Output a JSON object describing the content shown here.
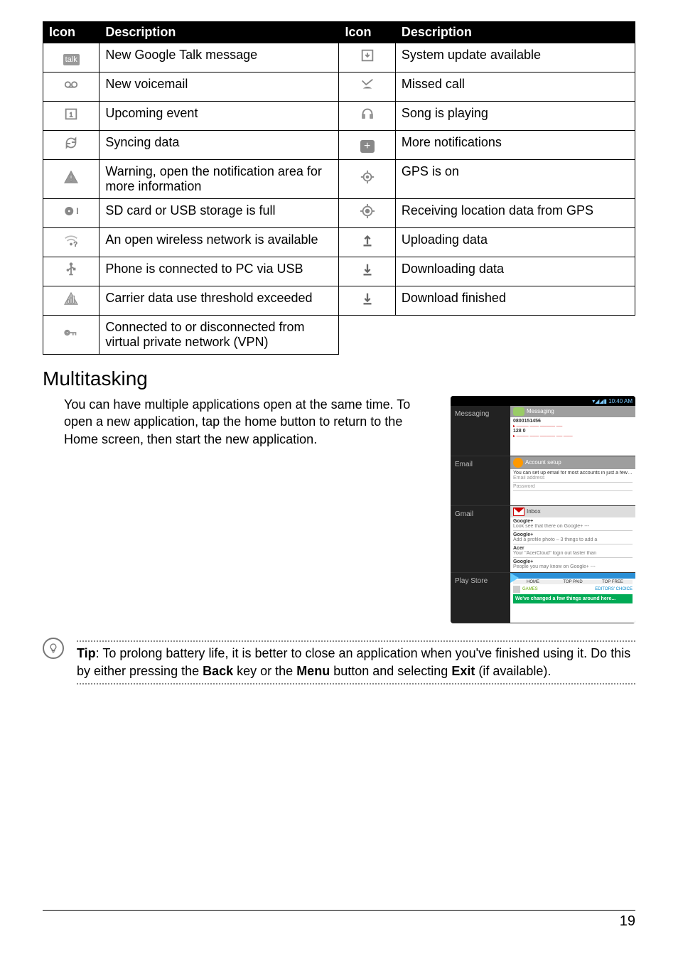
{
  "table": {
    "header": {
      "icon": "Icon",
      "desc": "Description"
    },
    "rows": [
      {
        "leftIcon": "talk-icon",
        "leftDesc": "New Google Talk message",
        "rightIcon": "download-available-icon",
        "rightDesc": "System update available"
      },
      {
        "leftIcon": "voicemail-icon",
        "leftDesc": "New voicemail",
        "rightIcon": "missed-call-icon",
        "rightDesc": "Missed call"
      },
      {
        "leftIcon": "calendar-icon",
        "leftDesc": "Upcoming event",
        "rightIcon": "headphones-icon",
        "rightDesc": "Song is playing"
      },
      {
        "leftIcon": "sync-icon",
        "leftDesc": "Syncing data",
        "rightIcon": "more-icon",
        "rightDesc": "More notifications"
      },
      {
        "leftIcon": "warning-icon",
        "leftDesc": "Warning, open the notification area for more information",
        "rightIcon": "gps-on-icon",
        "rightDesc": "GPS is on"
      },
      {
        "leftIcon": "storage-full-icon",
        "leftDesc": "SD card or USB storage is full",
        "rightIcon": "gps-receiving-icon",
        "rightDesc": "Receiving location data from GPS"
      },
      {
        "leftIcon": "wifi-open-icon",
        "leftDesc": "An open wireless network is available",
        "rightIcon": "upload-icon",
        "rightDesc": "Uploading data"
      },
      {
        "leftIcon": "usb-icon",
        "leftDesc": "Phone is connected to PC via USB",
        "rightIcon": "download-icon",
        "rightDesc": "Downloading data"
      },
      {
        "leftIcon": "data-threshold-icon",
        "leftDesc": "Carrier data use threshold exceeded",
        "rightIcon": "download-done-icon",
        "rightDesc": "Download finished"
      },
      {
        "leftIcon": "vpn-icon",
        "leftDesc": "Connected to or disconnected from virtual private network (VPN)",
        "rightIcon": "",
        "rightDesc": ""
      }
    ]
  },
  "section_title": "Multitasking",
  "multitasking_text": "You can have multiple applications open at the same time. To open a new application, tap the home button to return to the Home screen, then start the new application.",
  "phone": {
    "time": "10:40 AM",
    "apps": {
      "messaging": "Messaging",
      "email": "Email",
      "gmail": "Gmail",
      "playstore": "Play Store"
    },
    "messaging_card": {
      "header": "Messaging",
      "num": "0800151456",
      "text2": "128 0"
    },
    "email_card": {
      "header": "Account setup",
      "line1": "You can set up email for most accounts in just a few steps.",
      "field1": "Email address",
      "field2": "Password"
    },
    "gmail_card": {
      "inbox": "Inbox",
      "items": [
        {
          "sender": "Google+",
          "snippet": "Look see that there on Google+ ---"
        },
        {
          "sender": "Google+",
          "snippet": "Add a profile photo – 3 things to add a"
        },
        {
          "sender": "Acer",
          "snippet": "Your \"AcerCloud\" login out faster than"
        },
        {
          "sender": "Google+",
          "snippet": "People you may know on Google+ ---"
        }
      ]
    },
    "play_card": {
      "tab1": "HOME",
      "tab2": "TOP PAID",
      "tab3": "TOP FREE",
      "label_games": "GAMES",
      "label_ed": "EDITORS' CHOICE",
      "banner1": "We've changed a few things around here..."
    }
  },
  "tip": {
    "label": "Tip",
    "body_before": ": To prolong battery life, it is better to close an application when you've finished using it. Do this by either pressing the ",
    "bold1": "Back",
    "mid1": " key or the ",
    "bold2": "Menu",
    "mid2": " button and selecting ",
    "bold3": "Exit",
    "after": " (if available)."
  },
  "page_number": "19"
}
